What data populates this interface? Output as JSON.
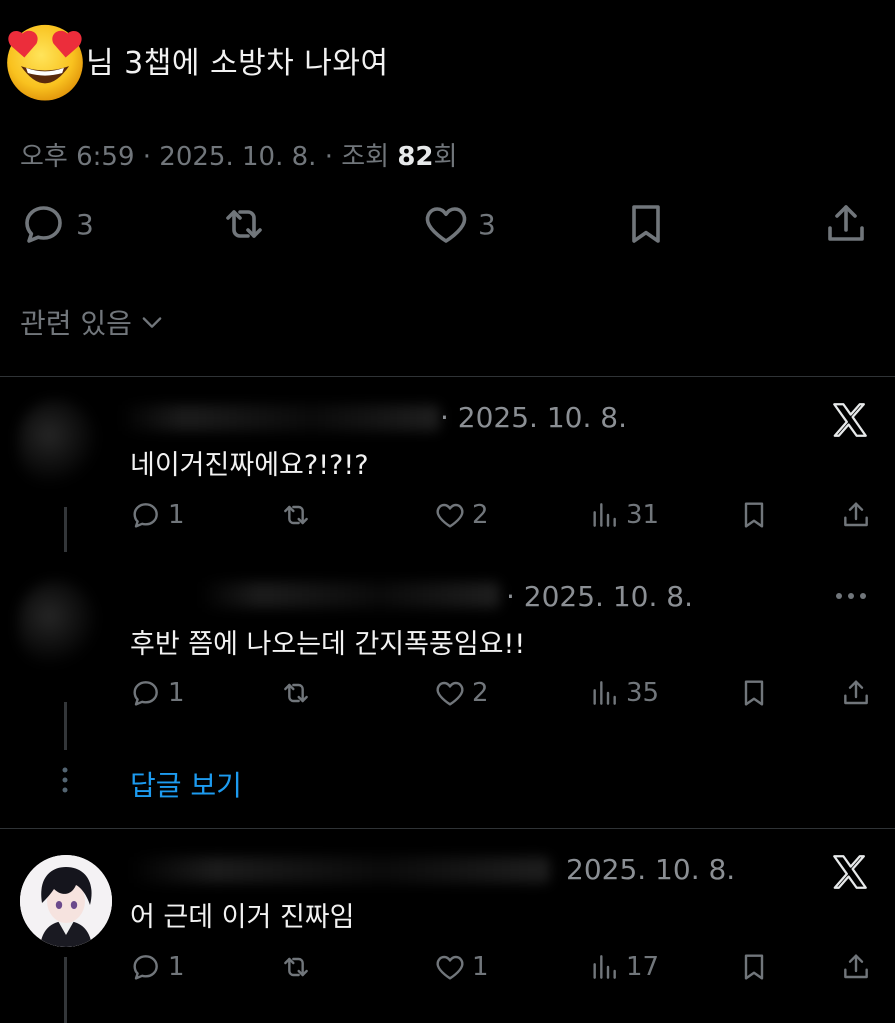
{
  "tweet": {
    "text": "님 3챕에 소방차 나와여",
    "emoji_icon": "heart-eyes-emoji"
  },
  "meta": {
    "time": "오후 6:59",
    "date": "2025. 10. 8.",
    "views_label": "조회",
    "views_count": "82",
    "views_suffix": "회"
  },
  "actions": {
    "replies": "3",
    "likes": "3"
  },
  "related_label": "관련 있음",
  "replies": [
    {
      "date": "· 2025. 10. 8.",
      "text": "네이거진짜에요?!?!?",
      "reply_count": "1",
      "like_count": "2",
      "view_count": "31",
      "corner_icon": "x-logo-icon"
    },
    {
      "date": "· 2025. 10. 8.",
      "text": "후반 쯤에 나오는데 간지폭풍임요!!",
      "reply_count": "1",
      "like_count": "2",
      "view_count": "35",
      "corner_icon": "more-icon"
    },
    {
      "date": "2025. 10. 8.",
      "text": "어 근데 이거 진짜임",
      "reply_count": "1",
      "like_count": "1",
      "view_count": "17",
      "corner_icon": "x-logo-icon"
    }
  ],
  "show_replies_label": "답글 보기",
  "colors": {
    "background": "#000000",
    "text": "#e7e9ea",
    "muted": "#71767b",
    "link": "#1d9bf0",
    "divider": "#2f3336"
  }
}
